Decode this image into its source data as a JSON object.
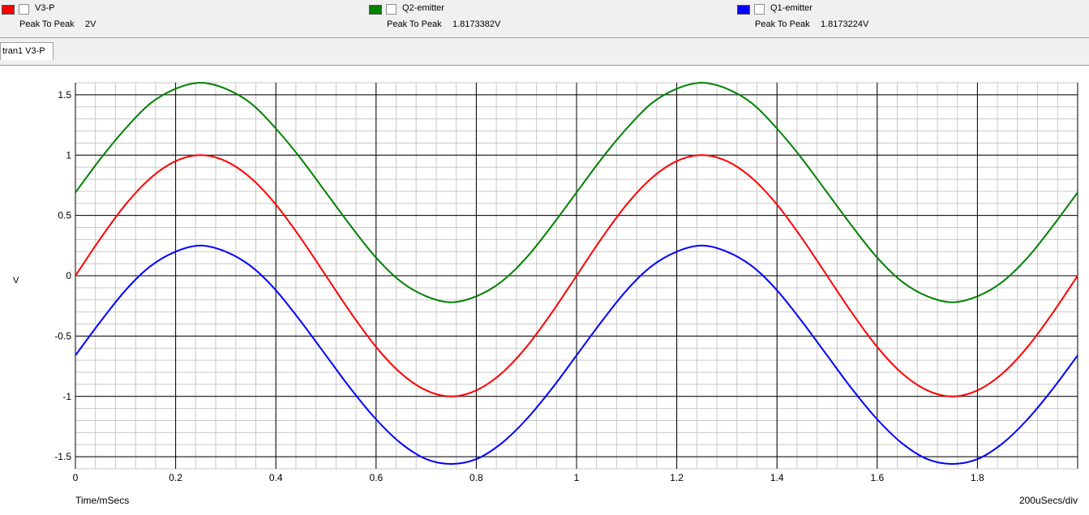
{
  "legend": [
    {
      "name": "V3-P",
      "color": "#ff0000",
      "pp_label": "Peak To Peak",
      "pp_value": "2V"
    },
    {
      "name": "Q2-emitter",
      "color": "#008000",
      "pp_label": "Peak To Peak",
      "pp_value": "1.8173382V"
    },
    {
      "name": "Q1-emitter",
      "color": "#0000ff",
      "pp_label": "Peak To Peak",
      "pp_value": "1.8173224V"
    }
  ],
  "tab": {
    "label": "tran1 V3-P"
  },
  "chart_data": {
    "type": "line",
    "xlabel": "Time/mSecs",
    "ylabel": "V",
    "scale_label": "200uSecs/div",
    "xlim": [
      0,
      2.0
    ],
    "ylim": [
      -1.6,
      1.6
    ],
    "x_ticks": [
      "0",
      "0.2",
      "0.4",
      "0.6",
      "0.8",
      "1",
      "1.2",
      "1.4",
      "1.6",
      "1.8"
    ],
    "y_ticks": [
      "1.5",
      "1",
      "0.5",
      "0",
      "-0.5",
      "-1",
      "-1.5"
    ],
    "grid": true,
    "series": [
      {
        "name": "V3-P",
        "color": "#ff0000",
        "x": [
          0,
          0.05,
          0.1,
          0.15,
          0.2,
          0.25,
          0.3,
          0.35,
          0.4,
          0.45,
          0.5,
          0.55,
          0.6,
          0.65,
          0.7,
          0.75,
          0.8,
          0.85,
          0.9,
          0.95,
          1.0,
          1.05,
          1.1,
          1.15,
          1.2,
          1.25,
          1.3,
          1.35,
          1.4,
          1.45,
          1.5,
          1.55,
          1.6,
          1.65,
          1.7,
          1.75,
          1.8,
          1.85,
          1.9,
          1.95,
          2.0
        ],
        "y": [
          0,
          0.31,
          0.59,
          0.81,
          0.95,
          1,
          0.95,
          0.81,
          0.59,
          0.31,
          0,
          -0.31,
          -0.59,
          -0.81,
          -0.95,
          -1,
          -0.95,
          -0.81,
          -0.59,
          -0.31,
          0,
          0.31,
          0.59,
          0.81,
          0.95,
          1,
          0.95,
          0.81,
          0.59,
          0.31,
          0,
          -0.31,
          -0.59,
          -0.81,
          -0.95,
          -1,
          -0.95,
          -0.81,
          -0.59,
          -0.31,
          0
        ]
      },
      {
        "name": "Q2-emitter",
        "color": "#008000",
        "x": [
          0,
          0.05,
          0.1,
          0.15,
          0.2,
          0.25,
          0.3,
          0.35,
          0.4,
          0.45,
          0.5,
          0.55,
          0.6,
          0.65,
          0.7,
          0.75,
          0.8,
          0.85,
          0.9,
          0.95,
          1.0,
          1.05,
          1.1,
          1.15,
          1.2,
          1.25,
          1.3,
          1.35,
          1.4,
          1.45,
          1.5,
          1.55,
          1.6,
          1.65,
          1.7,
          1.75,
          1.8,
          1.85,
          1.9,
          1.95,
          2.0
        ],
        "y": [
          0.69,
          0.97,
          1.22,
          1.43,
          1.55,
          1.6,
          1.55,
          1.43,
          1.22,
          0.97,
          0.69,
          0.41,
          0.15,
          -0.05,
          -0.17,
          -0.22,
          -0.17,
          -0.05,
          0.15,
          0.41,
          0.69,
          0.97,
          1.22,
          1.43,
          1.55,
          1.6,
          1.55,
          1.43,
          1.22,
          0.97,
          0.69,
          0.41,
          0.15,
          -0.05,
          -0.17,
          -0.22,
          -0.17,
          -0.05,
          0.15,
          0.41,
          0.69
        ]
      },
      {
        "name": "Q1-emitter",
        "color": "#0000ff",
        "x": [
          0,
          0.05,
          0.1,
          0.15,
          0.2,
          0.25,
          0.3,
          0.35,
          0.4,
          0.45,
          0.5,
          0.55,
          0.6,
          0.65,
          0.7,
          0.75,
          0.8,
          0.85,
          0.9,
          0.95,
          1.0,
          1.05,
          1.1,
          1.15,
          1.2,
          1.25,
          1.3,
          1.35,
          1.4,
          1.45,
          1.5,
          1.55,
          1.6,
          1.65,
          1.7,
          1.75,
          1.8,
          1.85,
          1.9,
          1.95,
          2.0
        ],
        "y": [
          -0.66,
          -0.38,
          -0.12,
          0.08,
          0.2,
          0.25,
          0.2,
          0.08,
          -0.12,
          -0.38,
          -0.66,
          -0.94,
          -1.19,
          -1.39,
          -1.52,
          -1.56,
          -1.52,
          -1.39,
          -1.19,
          -0.94,
          -0.66,
          -0.38,
          -0.12,
          0.08,
          0.2,
          0.25,
          0.2,
          0.08,
          -0.12,
          -0.38,
          -0.66,
          -0.94,
          -1.19,
          -1.39,
          -1.52,
          -1.56,
          -1.52,
          -1.39,
          -1.19,
          -0.94,
          -0.66
        ]
      }
    ]
  }
}
